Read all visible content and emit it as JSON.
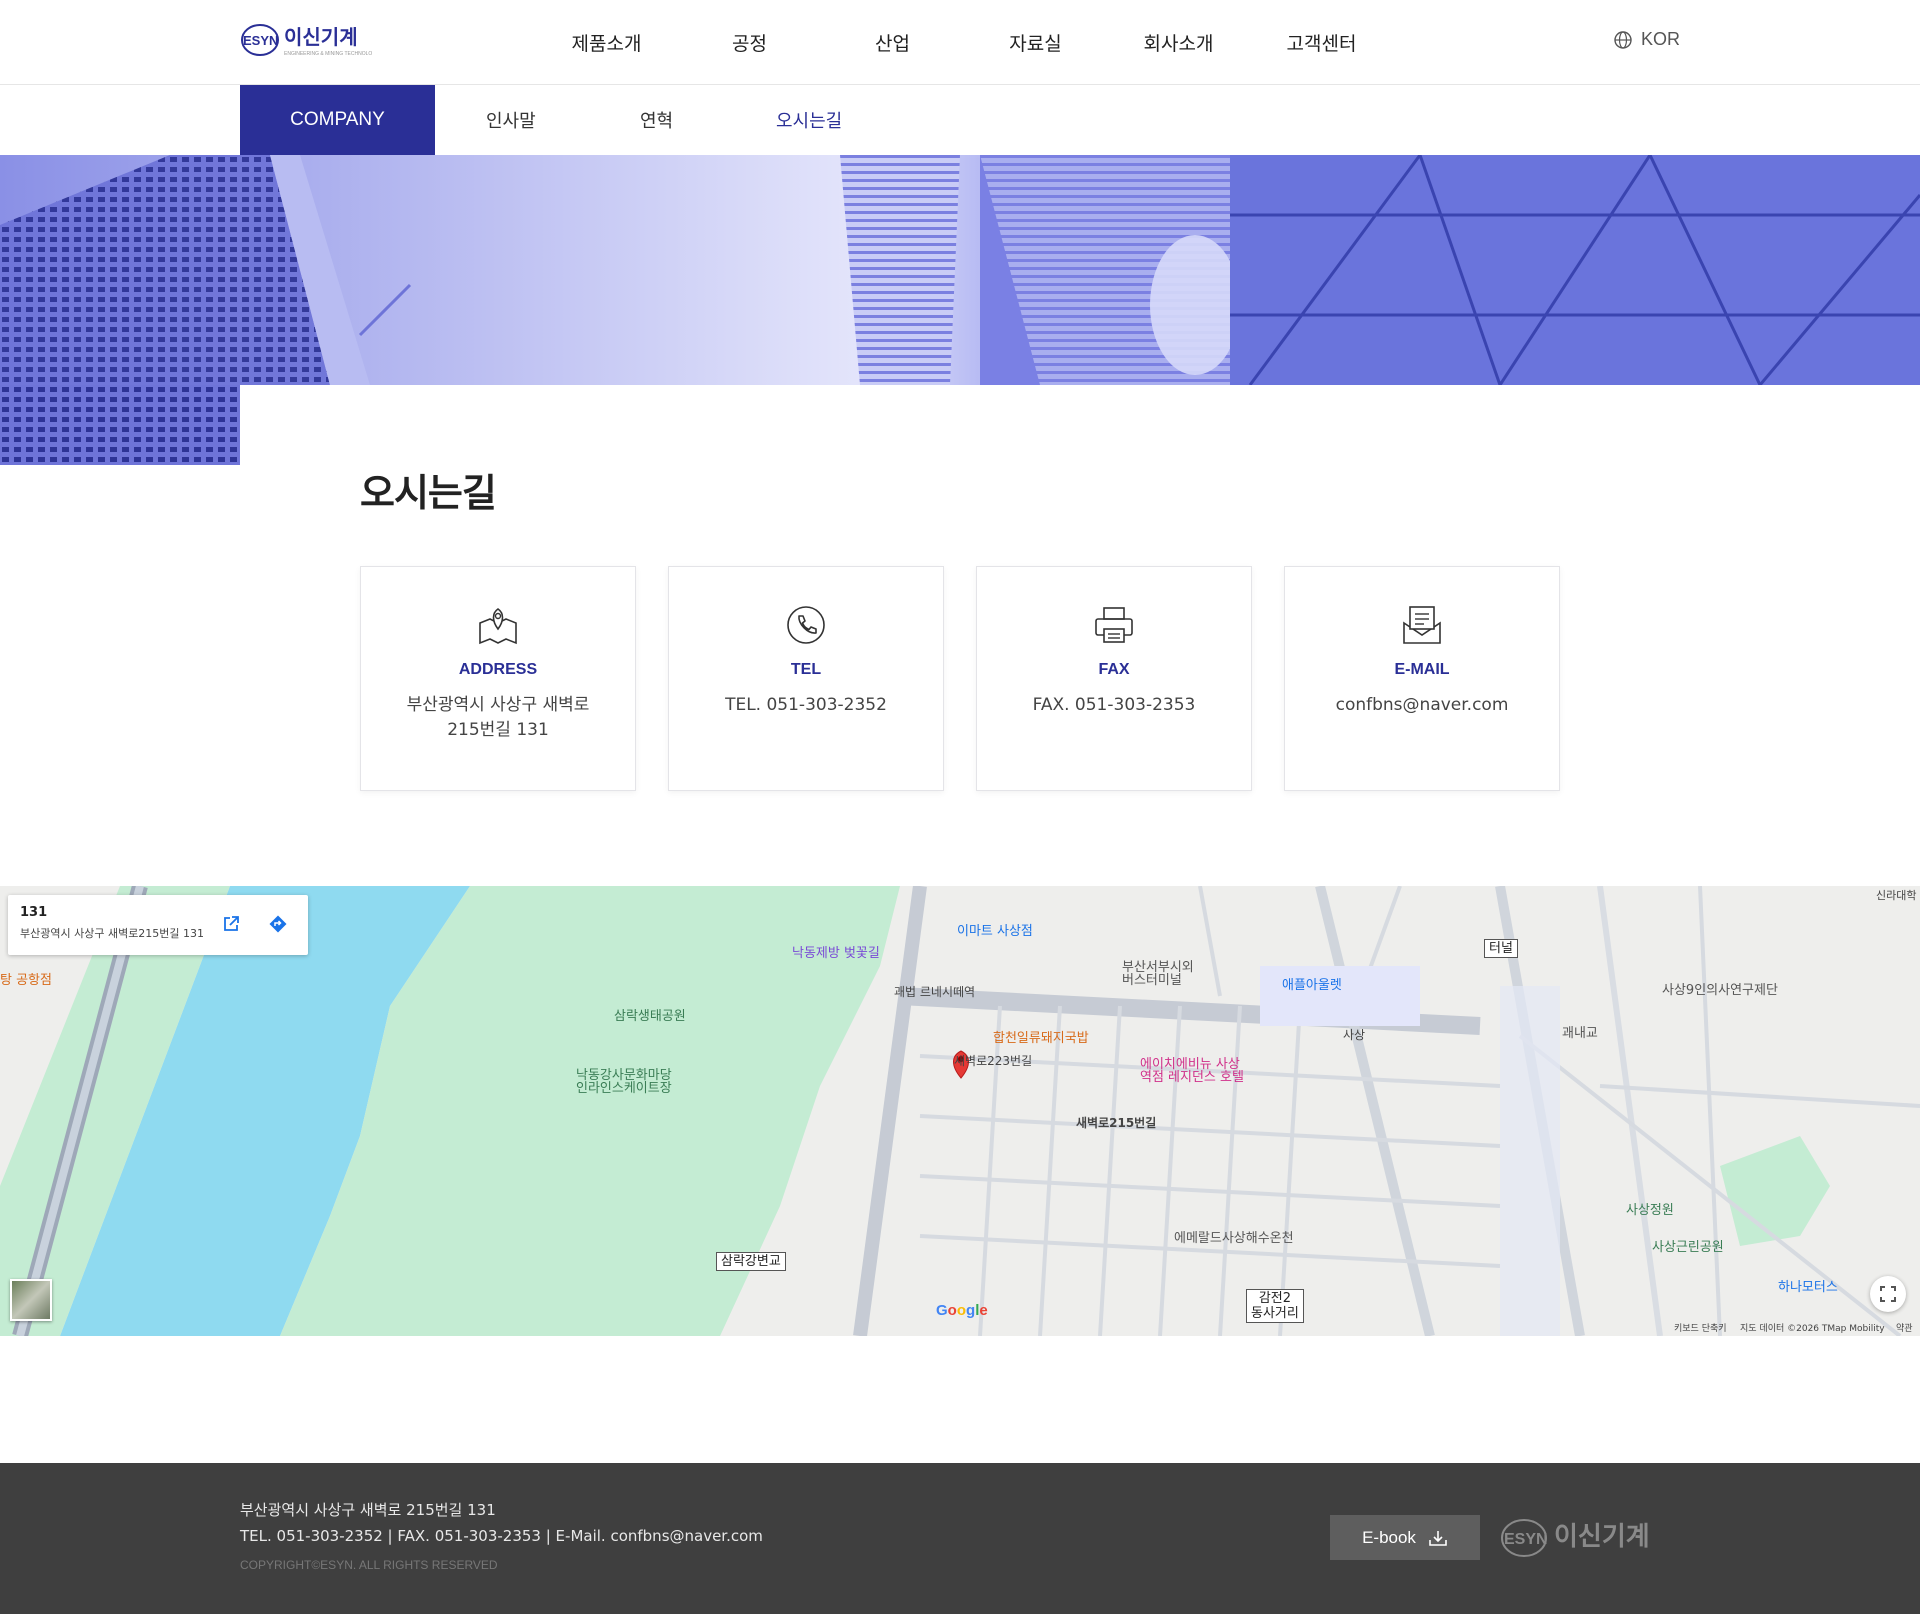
{
  "header": {
    "logo_brand": "ESYN",
    "logo_name": "이신기계",
    "nav": [
      "제품소개",
      "공정",
      "산업",
      "자료실",
      "회사소개",
      "고객센터"
    ],
    "lang": "KOR"
  },
  "subnav": {
    "section": "COMPANY",
    "items": [
      "인사말",
      "연혁",
      "오시는길"
    ],
    "active": "오시는길"
  },
  "page_title": "오시는길",
  "cards": [
    {
      "icon": "map-pin-icon",
      "title": "ADDRESS",
      "text": "부산광역시 사상구 새벽로 215번길 131"
    },
    {
      "icon": "phone-icon",
      "title": "TEL",
      "text": "TEL. 051-303-2352"
    },
    {
      "icon": "printer-icon",
      "title": "FAX",
      "text": "FAX. 051-303-2353"
    },
    {
      "icon": "mail-icon",
      "title": "E-MAIL",
      "text": "confbns@naver.com"
    }
  ],
  "map": {
    "info_title": "131",
    "info_address": "부산광역시 사상구 새벽로215번길 131",
    "labels": {
      "emart": "이마트 사상점",
      "nakdong_park": "낙동제방 벚꽃길",
      "bus_terminal": "부산서부시외\n버스터미널",
      "apple_outlet": "애플아울렛",
      "sangnak_park": "삼락생태공원",
      "nakdong_culture": "낙동강사문화마당\n인라인스케이트장",
      "gaebeop": "괘법 르네시떼역",
      "hapjeon": "합천일류돼지국밥",
      "hotel": "에이치에비뉴 사상\n역점 레지던스 호텔",
      "sasang": "사상",
      "tunnel": "터널",
      "sasang_institute": "사상9인의사연구제단",
      "gwaenaegyo": "괘내교",
      "sasang_garden": "사상정원",
      "sasang_park": "사상근린공원",
      "hana_motors": "하나모터스",
      "emerald": "에메랄드사상해수온천",
      "samnak_bridge": "삼락강변교",
      "gamjeon": "감전2\n동사거리",
      "saebyeok223": "새벽로223번길",
      "saebyeok215": "새벽로215번길",
      "airport": "탕 공항점",
      "silla": "신라대학"
    },
    "footer_keyboard": "키보드 단축키",
    "footer_data": "지도 데이터 ©2026 TMap Mobility",
    "footer_terms": "약관",
    "google": "Google"
  },
  "footer": {
    "address": "부산광역시 사상구 새벽로 215번길 131",
    "contact": "TEL. 051-303-2352 | FAX. 051-303-2353 | E-Mail. confbns@naver.com",
    "copyright": "COPYRIGHT©ESYN. ALL RIGHTS RESERVED",
    "ebook": "E-book"
  },
  "colors": {
    "accent": "#2a2f96",
    "footer_bg": "#3f3f3f"
  }
}
